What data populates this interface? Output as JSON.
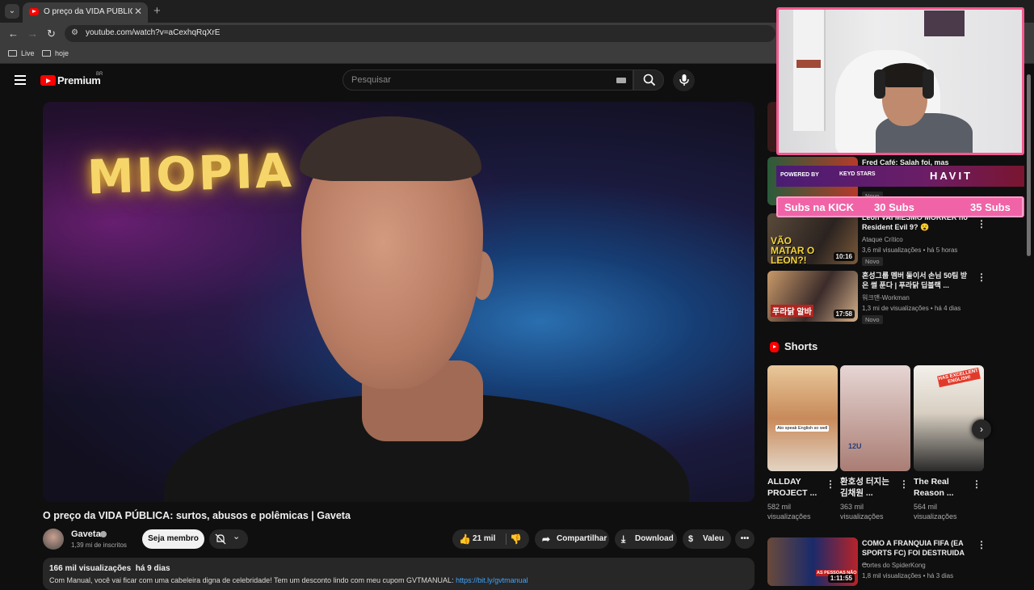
{
  "browser": {
    "tab_title": "O preço da VIDA PÚBLICA: surtos",
    "tab_close": "✕",
    "new_tab": "+",
    "url": "youtube.com/watch?v=aCexhqRqXrE",
    "bookmarks": [
      "Live",
      "hoje"
    ]
  },
  "header": {
    "logo_text": "Premium",
    "logo_region": "BR",
    "search_placeholder": "Pesquisar"
  },
  "video": {
    "sign_text": "MIOPIA",
    "title": "O preço da VIDA PÚBLICA: surtos, abusos e polêmicas | Gaveta",
    "channel": "Gaveta",
    "subscribers": "1,39 mi de inscritos",
    "member_label": "Seja membro",
    "likes": "21 mil",
    "share_label": "Compartilhar",
    "download_label": "Download",
    "thanks_label": "Valeu",
    "more_label": "•••",
    "views": "166 mil visualizações",
    "age": "há 9 dias",
    "description": "Com Manual, você vai ficar com uma cabeleira digna de celebridade! Tem um desconto lindo com meu cupom GVTMANUAL: ",
    "description_link": "https://bit.ly/gvtmanual"
  },
  "recommendations": [
    {
      "title": "Fred Café: Salah foi, mas volta?",
      "channel": "",
      "meta": "",
      "badge": "Novo",
      "duration": ""
    },
    {
      "title": "Leon VAI MESMO MORRER no Resident Evil 9? 😮",
      "channel": "Ataque Crítico",
      "meta": "3,6 mil visualizações • há 5 horas",
      "badge": "Novo",
      "duration": "10:16",
      "thumb_text": "VÃO MATAR O LEON?!"
    },
    {
      "title": "혼성그룹 멤버 둘이서 손님 50팀 받은 썰 푼다 | 푸라닭 딥블랙 ...",
      "channel": "워크맨-Workman",
      "meta": "1,3 mi de visualizações • há 4 dias",
      "badge": "Novo",
      "duration": "17:58",
      "thumb_text": "푸라닭 알바"
    },
    {
      "title": "COMO A FRANQUIA FIFA (EA SPORTS FC) FOI DESTRUIDA ...",
      "channel": "Cortes do SpiderKong",
      "meta": "1,8 mil visualizações • há 3 dias",
      "badge": "",
      "duration": "1:11:55",
      "thumb_text": "AS PESSOAS NÃO"
    }
  ],
  "shorts": {
    "heading": "Shorts",
    "items": [
      {
        "title": "ALLDAY PROJECT ...",
        "views": "582 mil visualizações",
        "caption": "Ato speak English so well"
      },
      {
        "title": "환호성 터지는 김채원 ...",
        "views": "363 mil visualizações",
        "caption": "12U"
      },
      {
        "title": "The Real Reason ...",
        "views": "564 mil visualizações",
        "caption": "HAS EXCELLENT ENGLISH!"
      }
    ]
  },
  "overlay": {
    "sponsor_powered": "POWERED BY",
    "sponsor_brand1": "KEYD STARS",
    "sponsor_brand2": "HAVIT",
    "subgoal_label": "Subs na KICK",
    "subgoal_current": "30 Subs",
    "subgoal_target": "35 Subs"
  },
  "colors": {
    "accent": "#ff0000",
    "link": "#3ea6ff",
    "overlay_pink": "#f063a6"
  }
}
